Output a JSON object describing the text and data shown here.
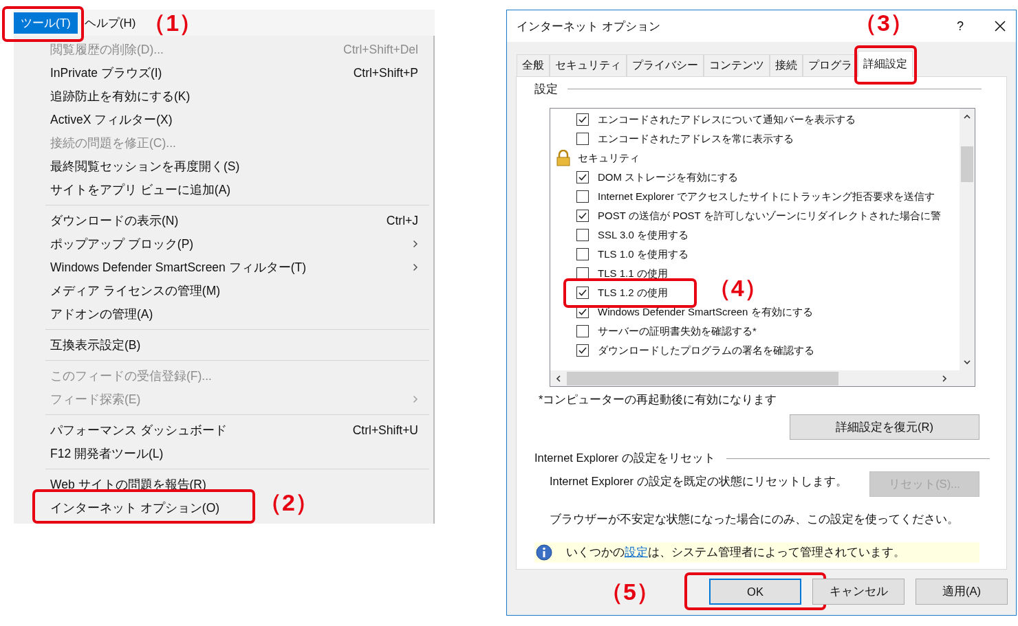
{
  "menubar": [
    {
      "label": "ツール(T)",
      "selected": true,
      "callout": "（1）"
    },
    {
      "label": "ヘルプ(H)",
      "selected": false
    }
  ],
  "menu": {
    "groups": [
      {
        "items": [
          {
            "label": "閲覧履歴の削除(D)...",
            "shortcut": "Ctrl+Shift+Del",
            "disabled": true,
            "submenu": false
          },
          {
            "label": "InPrivate ブラウズ(I)",
            "shortcut": "Ctrl+Shift+P",
            "disabled": false,
            "submenu": false
          },
          {
            "label": "追跡防止を有効にする(K)",
            "disabled": false,
            "submenu": false
          },
          {
            "label": "ActiveX フィルター(X)",
            "disabled": false,
            "submenu": false
          },
          {
            "label": "接続の問題を修正(C)...",
            "disabled": true,
            "submenu": false
          },
          {
            "label": "最終閲覧セッションを再度開く(S)",
            "disabled": false,
            "submenu": false
          },
          {
            "label": "サイトをアプリ ビューに追加(A)",
            "disabled": false,
            "submenu": false
          }
        ]
      },
      {
        "items": [
          {
            "label": "ダウンロードの表示(N)",
            "shortcut": "Ctrl+J",
            "disabled": false,
            "submenu": false
          },
          {
            "label": "ポップアップ ブロック(P)",
            "disabled": false,
            "submenu": true
          },
          {
            "label": "Windows Defender SmartScreen フィルター(T)",
            "disabled": false,
            "submenu": true
          },
          {
            "label": "メディア ライセンスの管理(M)",
            "disabled": false,
            "submenu": false
          },
          {
            "label": "アドオンの管理(A)",
            "disabled": false,
            "submenu": false
          }
        ]
      },
      {
        "items": [
          {
            "label": "互換表示設定(B)",
            "disabled": false,
            "submenu": false
          }
        ]
      },
      {
        "items": [
          {
            "label": "このフィードの受信登録(F)...",
            "disabled": true,
            "submenu": false
          },
          {
            "label": "フィード探索(E)",
            "disabled": true,
            "submenu": true
          }
        ]
      },
      {
        "items": [
          {
            "label": "パフォーマンス ダッシュボード",
            "shortcut": "Ctrl+Shift+U",
            "disabled": false,
            "submenu": false
          },
          {
            "label": "F12 開発者ツール(L)",
            "disabled": false,
            "submenu": false
          }
        ]
      },
      {
        "items": [
          {
            "label": "Web サイトの問題を報告(R)",
            "disabled": false,
            "submenu": false
          },
          {
            "label": "インターネット オプション(O)",
            "disabled": false,
            "submenu": false,
            "callout": "（2）"
          }
        ]
      }
    ]
  },
  "dialog": {
    "title": "インターネット オプション",
    "help": "?",
    "tabs": [
      {
        "label": "全般",
        "selected": false
      },
      {
        "label": "セキュリティ",
        "selected": false
      },
      {
        "label": "プライバシー",
        "selected": false
      },
      {
        "label": "コンテンツ",
        "selected": false
      },
      {
        "label": "接続",
        "selected": false
      },
      {
        "label": "プログラ",
        "selected": false
      },
      {
        "label": "詳細設定",
        "selected": true,
        "callout": "（3）"
      }
    ],
    "settings_heading": "設定",
    "settings": [
      {
        "kind": "checkbox",
        "label": "エンコードされたアドレスについて通知バーを表示する",
        "checked": true
      },
      {
        "kind": "checkbox",
        "label": "エンコードされたアドレスを常に表示する",
        "checked": false
      },
      {
        "kind": "category",
        "label": "セキュリティ"
      },
      {
        "kind": "checkbox",
        "label": "DOM ストレージを有効にする",
        "checked": true
      },
      {
        "kind": "checkbox",
        "label": "Internet Explorer でアクセスしたサイトにトラッキング拒否要求を送信す",
        "checked": false
      },
      {
        "kind": "checkbox",
        "label": "POST の送信が POST を許可しないゾーンにリダイレクトされた場合に警",
        "checked": true
      },
      {
        "kind": "checkbox",
        "label": "SSL 3.0 を使用する",
        "checked": false
      },
      {
        "kind": "checkbox",
        "label": "TLS 1.0 を使用する",
        "checked": false
      },
      {
        "kind": "checkbox",
        "label": "TLS 1.1 の使用",
        "checked": false
      },
      {
        "kind": "checkbox",
        "label": "TLS 1.2 の使用",
        "checked": true,
        "callout": "（4）"
      },
      {
        "kind": "checkbox",
        "label": "Windows Defender SmartScreen を有効にする",
        "checked": true
      },
      {
        "kind": "checkbox",
        "label": "サーバーの証明書失効を確認する*",
        "checked": false
      },
      {
        "kind": "checkbox",
        "label": "ダウンロードしたプログラムの署名を確認する",
        "checked": true
      }
    ],
    "restart_note": "*コンピューターの再起動後に有効になります",
    "restore_button": {
      "label": "詳細設定を復元(R)",
      "disabled": false
    },
    "reset_heading": "Internet Explorer の設定をリセット",
    "reset_description": "Internet Explorer の設定を既定の状態にリセットします。",
    "reset_button": {
      "label": "リセット(S)...",
      "disabled": true
    },
    "reset_warning": "ブラウザーが不安定な状態になった場合にのみ、この設定を使ってください。",
    "info": {
      "before": "いくつかの",
      "link": "設定",
      "after": "は、システム管理者によって管理されています。"
    },
    "buttons": [
      {
        "label": "OK",
        "focused": true,
        "callout": "（5）"
      },
      {
        "label": "キャンセル",
        "focused": false
      },
      {
        "label": "適用(A)",
        "focused": false
      }
    ]
  }
}
